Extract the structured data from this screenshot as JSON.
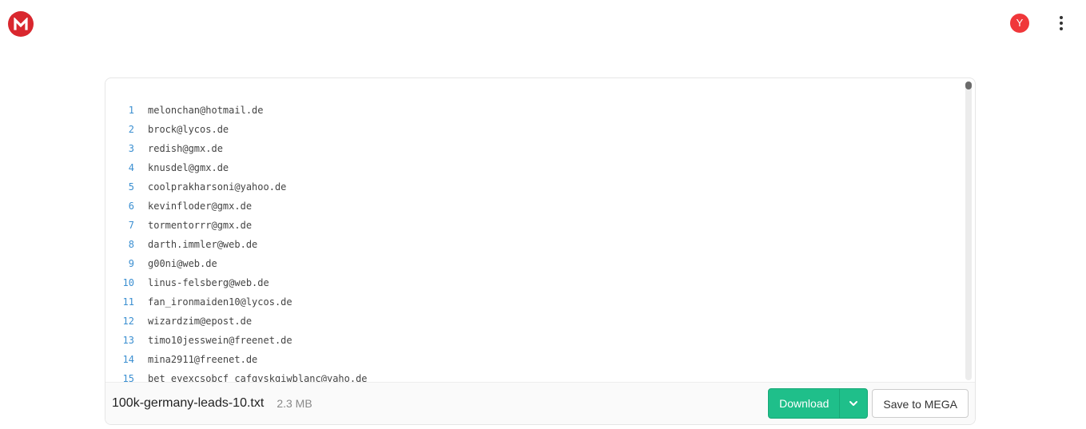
{
  "header": {
    "logo_icon": "mega-logo-icon",
    "avatar_initial": "Y",
    "menu_icon": "more-vertical-icon"
  },
  "colors": {
    "brand": "#d9272e",
    "avatar": "#f0373a",
    "download": "#1fbf8a",
    "line_number": "#3b8fd1"
  },
  "file": {
    "lines": [
      {
        "n": "1",
        "text": "melonchan@hotmail.de"
      },
      {
        "n": "2",
        "text": "brock@lycos.de"
      },
      {
        "n": "3",
        "text": "redish@gmx.de"
      },
      {
        "n": "4",
        "text": "knusdel@gmx.de"
      },
      {
        "n": "5",
        "text": "coolprakharsoni@yahoo.de"
      },
      {
        "n": "6",
        "text": "kevinfloder@gmx.de"
      },
      {
        "n": "7",
        "text": "tormentorrr@gmx.de"
      },
      {
        "n": "8",
        "text": "darth.immler@web.de"
      },
      {
        "n": "9",
        "text": "g00ni@web.de"
      },
      {
        "n": "10",
        "text": "linus-felsberg@web.de"
      },
      {
        "n": "11",
        "text": "fan_ironmaiden10@lycos.de"
      },
      {
        "n": "12",
        "text": "wizardzim@epost.de"
      },
      {
        "n": "13",
        "text": "timo10jesswein@freenet.de"
      },
      {
        "n": "14",
        "text": "mina2911@freenet.de"
      },
      {
        "n": "15",
        "text": "bet_eyexcsobcf_cafgyskgiwblanc@yaho.de"
      }
    ],
    "scroll_position": 0.0
  },
  "footer": {
    "filename": "100k-germany-leads-10.txt",
    "filesize": "2.3 MB",
    "download_label": "Download",
    "save_label": "Save to MEGA"
  }
}
